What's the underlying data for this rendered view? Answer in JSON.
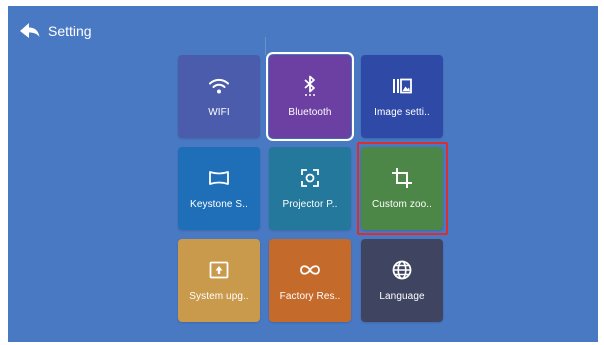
{
  "header": {
    "title": "Setting",
    "back_icon": "back-arrow-icon"
  },
  "colors": {
    "background": "#4a79c4",
    "selection_outline": "#ffffff",
    "highlight_frame": "#d9302f"
  },
  "tiles": [
    {
      "label": "WIFI",
      "icon": "wifi-icon",
      "color": "#4b5cad"
    },
    {
      "label": "Bluetooth",
      "icon": "bluetooth-icon",
      "color": "#6c3fa3",
      "selected": true
    },
    {
      "label": "Image setti..",
      "icon": "image-settings-icon",
      "color": "#2f4aa6"
    },
    {
      "label": "Keystone S..",
      "icon": "keystone-icon",
      "color": "#1e6fb8"
    },
    {
      "label": "Projector P..",
      "icon": "projector-position-icon",
      "color": "#23789b"
    },
    {
      "label": "Custom zoo..",
      "icon": "crop-icon",
      "color": "#4c8747",
      "highlighted": true
    },
    {
      "label": "System upg..",
      "icon": "system-upgrade-icon",
      "color": "#c9994c"
    },
    {
      "label": "Factory Res..",
      "icon": "factory-reset-icon",
      "color": "#c46a2b"
    },
    {
      "label": "Language",
      "icon": "globe-icon",
      "color": "#3f4560"
    }
  ]
}
